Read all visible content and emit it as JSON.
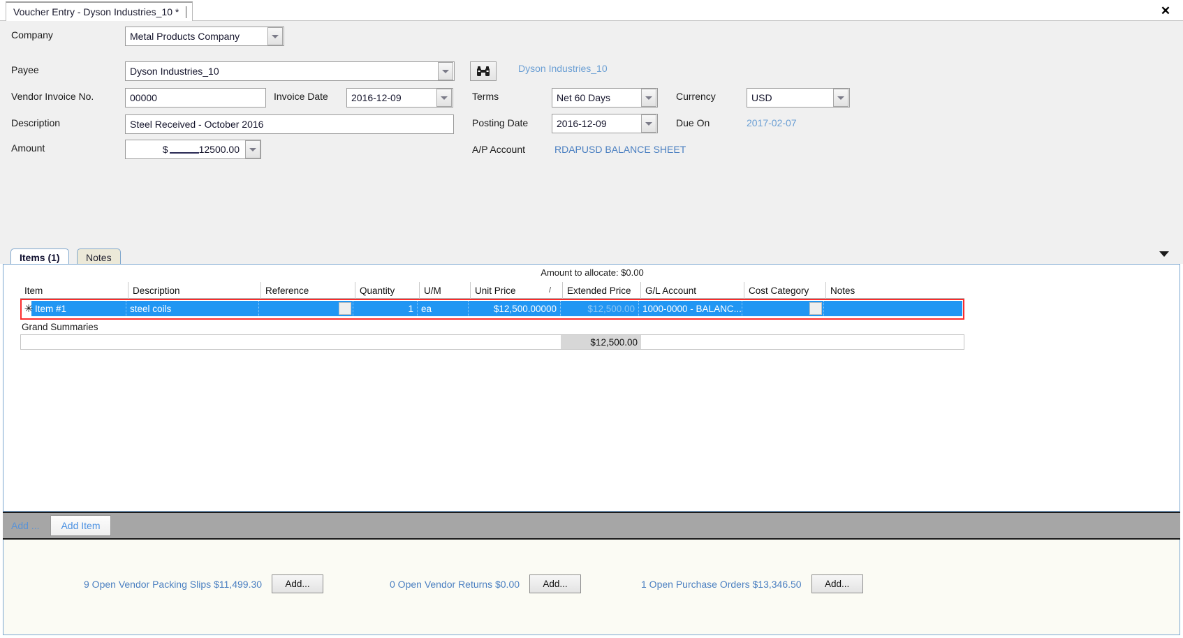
{
  "window": {
    "tab_title": "Voucher Entry - Dyson Industries_10 *",
    "close_icon": "close-icon"
  },
  "form": {
    "company": {
      "label": "Company",
      "value": "Metal Products Company"
    },
    "payee": {
      "label": "Payee",
      "value": "Dyson Industries_10"
    },
    "payee_lookup_icon": "binoculars-icon",
    "payee_link": "Dyson Industries_10",
    "vendor_invoice_no": {
      "label": "Vendor Invoice No.",
      "value": "00000"
    },
    "invoice_date": {
      "label": "Invoice Date",
      "value": "2016-12-09"
    },
    "description": {
      "label": "Description",
      "value": "Steel Received - October 2016"
    },
    "amount": {
      "label": "Amount",
      "currency_symbol": "$",
      "value": "12500.00"
    },
    "terms": {
      "label": "Terms",
      "value": "Net 60 Days"
    },
    "posting_date": {
      "label": "Posting Date",
      "value": "2016-12-09"
    },
    "ap_account": {
      "label": "A/P Account",
      "value": "RDAPUSD BALANCE SHEET"
    },
    "currency": {
      "label": "Currency",
      "value": "USD"
    },
    "due_on": {
      "label": "Due On",
      "value": "2017-02-07"
    }
  },
  "tabs": {
    "items": "Items (1)",
    "notes": "Notes",
    "overflow_icon": "chevron-down-icon"
  },
  "grid": {
    "allocate_note": "Amount to allocate: $0.00",
    "columns": [
      "Item",
      "Description",
      "Reference",
      "Quantity",
      "U/M",
      "Unit Price",
      "Extended Price",
      "G/L Account",
      "Cost Category",
      "Notes"
    ],
    "unit_price_sort_mark": "/",
    "row": {
      "marker": "✳",
      "item": "Item #1",
      "description": "steel coils",
      "reference": "",
      "quantity": "1",
      "um": "ea",
      "unit_price": "$12,500.00000",
      "extended_price": "$12,500.00",
      "gl_account": "1000-0000  -  BALANC...",
      "cost_category": "",
      "notes": ""
    },
    "grand_summaries_label": "Grand Summaries",
    "grand_total": "$12,500.00"
  },
  "addbar": {
    "add_ellipsis": "Add ...",
    "add_item_label": "Add Item"
  },
  "status": {
    "groups": [
      {
        "label": "9 Open Vendor Packing Slips $11,499.30",
        "button": "Add..."
      },
      {
        "label": "0 Open Vendor Returns $0.00",
        "button": "Add..."
      },
      {
        "label": "1 Open Purchase Orders $13,346.50",
        "button": "Add..."
      }
    ]
  },
  "colors": {
    "selection_blue": "#2196f3",
    "highlight_red": "#fb2c2c",
    "link_blue": "#4a7fc1",
    "panel_gray": "#f0f0f0"
  }
}
